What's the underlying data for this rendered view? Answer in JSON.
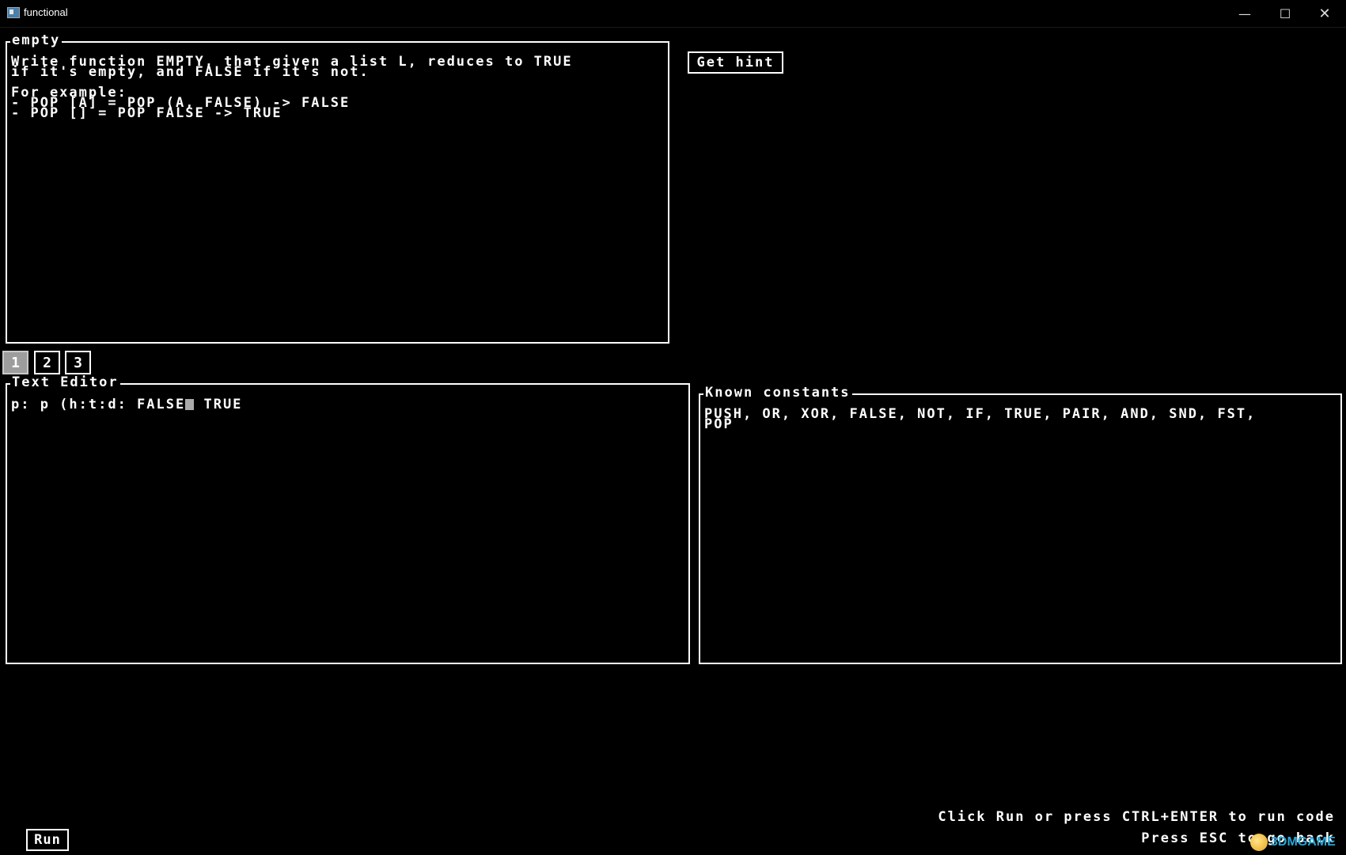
{
  "window": {
    "title": "functional",
    "minimize_glyph": "—",
    "maximize_glyph": "☐",
    "close_glyph": "✕"
  },
  "problem": {
    "label": "empty",
    "text": "Write function EMPTY, that given a list L, reduces to TRUE\nif it's empty, and FALSE if it's not.\n\nFor example:\n- POP [A] = POP (A, FALSE) -> FALSE\n- POP [] = POP FALSE -> TRUE"
  },
  "hint_button": {
    "label": "Get hint"
  },
  "tabs": [
    {
      "label": "1",
      "active": true
    },
    {
      "label": "2",
      "active": false
    },
    {
      "label": "3",
      "active": false
    }
  ],
  "editor": {
    "label": "Text Editor",
    "code_before_cursor": "p: p (h:t:d: FALSE",
    "code_after_cursor": " TRUE"
  },
  "constants": {
    "label": "Known constants",
    "text": "PUSH, OR, XOR, FALSE, NOT, IF, TRUE, PAIR, AND, SND, FST,\nPOP"
  },
  "help": {
    "line1": "Click Run or press CTRL+ENTER to run code",
    "line2": "Press ESC to go back"
  },
  "run_button": {
    "label": "Run"
  },
  "watermark": {
    "text": "3DMGAME"
  }
}
